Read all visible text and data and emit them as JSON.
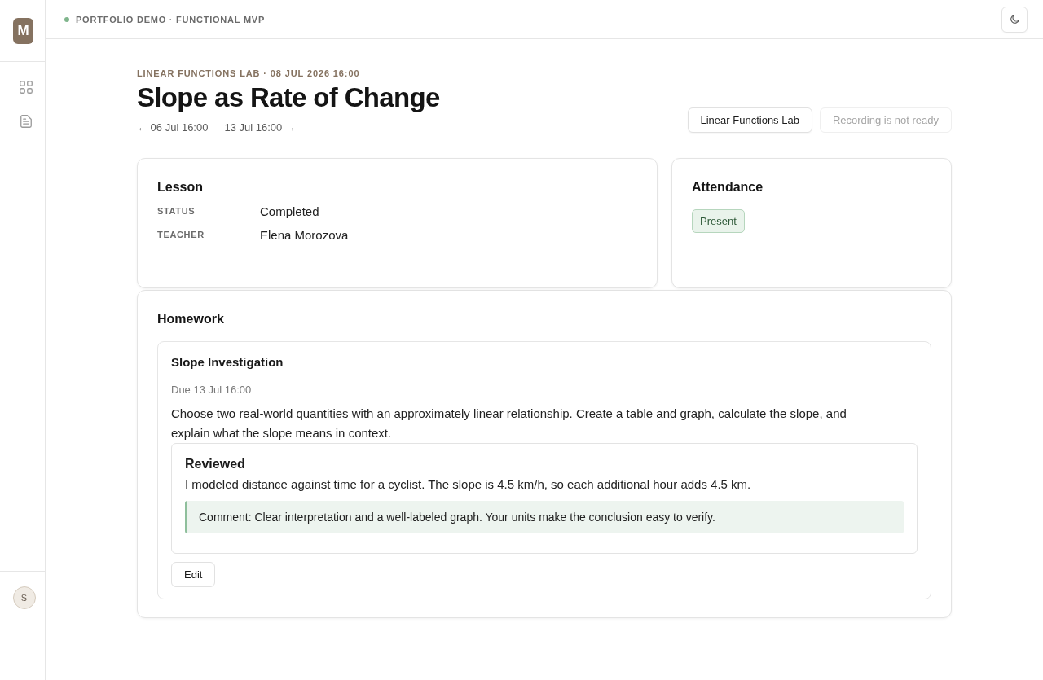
{
  "sidebar": {
    "logo": "M",
    "user_avatar": "S"
  },
  "header": {
    "label": "PORTFOLIO DEMO · FUNCTIONAL MVP"
  },
  "page": {
    "eyebrow": "LINEAR FUNCTIONS LAB · 08 JUL 2026 16:00",
    "title": "Slope as Rate of Change",
    "prev_link": "← 06 Jul 16:00",
    "next_link": "13 Jul 16:00 →",
    "actions": [
      {
        "label": "Linear Functions Lab",
        "disabled": false
      },
      {
        "label": "Recording is not ready",
        "disabled": true
      }
    ]
  },
  "lesson": {
    "title": "Lesson",
    "fields": [
      {
        "label": "STATUS",
        "value": "Completed"
      },
      {
        "label": "TEACHER",
        "value": "Elena Morozova"
      }
    ]
  },
  "attendance": {
    "title": "Attendance",
    "badge": "Present"
  },
  "homework": {
    "title": "Homework",
    "assignments": [
      {
        "title": "Slope Investigation",
        "due": "Due 13 Jul 16:00",
        "description": "Choose two real-world quantities with an approximately linear relationship. Create a table and graph, calculate the slope, and explain what the slope means in context.",
        "submission": {
          "status": "Reviewed",
          "text": "I modeled distance against time for a cyclist. The slope is 4.5 km/h, so each additional hour adds 4.5 km.",
          "comment": "Comment: Clear interpretation and a well-labeled graph. Your units make the conclusion easy to verify."
        },
        "button": "Edit"
      }
    ]
  }
}
